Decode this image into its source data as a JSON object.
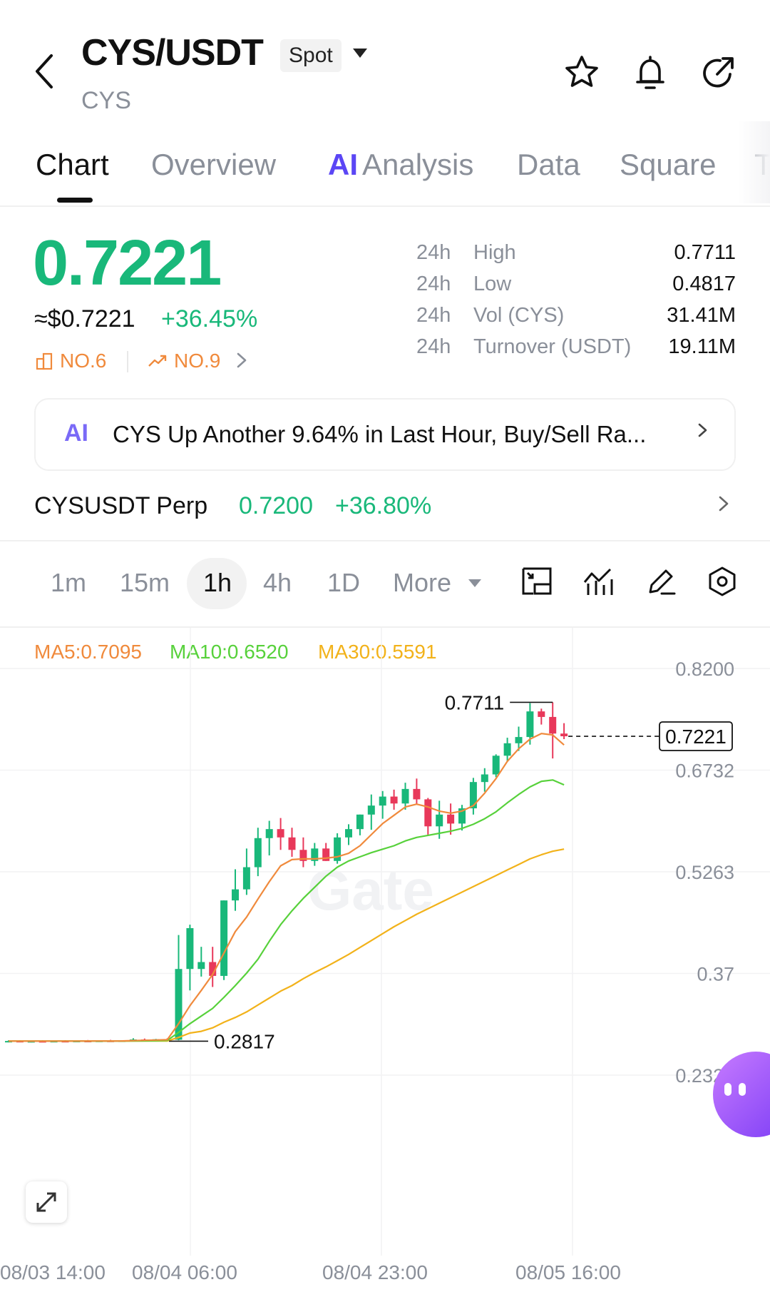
{
  "header": {
    "pair": "CYS/USDT",
    "market_type": "Spot",
    "base_asset": "CYS",
    "icons": [
      "back-arrow-icon",
      "star-icon",
      "bell-icon",
      "share-icon"
    ]
  },
  "tabs": [
    {
      "label": "Chart",
      "active": true
    },
    {
      "label": "Overview",
      "active": false
    },
    {
      "label": "Analysis",
      "prefix": "AI",
      "active": false
    },
    {
      "label": "Data",
      "active": false
    },
    {
      "label": "Square",
      "active": false
    },
    {
      "label": "T",
      "active": false
    }
  ],
  "price": {
    "last": "0.7221",
    "usd_approx": "≈$0.7221",
    "change_pct": "+36.45%",
    "rank_1": "NO.6",
    "rank_2": "NO.9"
  },
  "stats": [
    {
      "period": "24h",
      "label": "High",
      "value": "0.7711"
    },
    {
      "period": "24h",
      "label": "Low",
      "value": "0.4817"
    },
    {
      "period": "24h",
      "label": "Vol (CYS)",
      "value": "31.41M"
    },
    {
      "period": "24h",
      "label": "Turnover (USDT)",
      "value": "19.11M"
    }
  ],
  "news": {
    "ai_tag": "AI",
    "headline": "CYS Up Another 9.64% in Last Hour, Buy/Sell Ra..."
  },
  "perp": {
    "name": "CYSUSDT Perp",
    "price": "0.7200",
    "change_pct": "+36.80%"
  },
  "intervals": {
    "items": [
      "1m",
      "15m",
      "1h",
      "4h",
      "1D",
      "More"
    ],
    "selected": "1h"
  },
  "ma": {
    "ma5": "MA5:0.7095",
    "ma10": "MA10:0.6520",
    "ma30": "MA30:0.5591"
  },
  "colors": {
    "up": "#19b87a",
    "down": "#e8385a",
    "ma5": "#f08a3c",
    "ma10": "#57d13b",
    "ma30": "#f2b21a",
    "accent": "#5b46f5"
  },
  "chart_data": {
    "type": "candlestick",
    "interval": "1h",
    "y_ticks": [
      "0.8200",
      "0.6732",
      "0.5263",
      "0.37",
      "0.2327"
    ],
    "x_ticks": [
      "08/03 14:00",
      "08/04 06:00",
      "08/04 23:00",
      "08/05 16:00"
    ],
    "ylim": [
      0.2327,
      0.82
    ],
    "high_marker": "0.7711",
    "low_marker": "0.2817",
    "last_price_tag": "0.7221",
    "watermark": "Gate",
    "candles": [
      {
        "o": 0.281,
        "h": 0.283,
        "l": 0.28,
        "c": 0.282
      },
      {
        "o": 0.282,
        "h": 0.283,
        "l": 0.2805,
        "c": 0.2812
      },
      {
        "o": 0.2812,
        "h": 0.2825,
        "l": 0.28,
        "c": 0.2818
      },
      {
        "o": 0.2818,
        "h": 0.283,
        "l": 0.2808,
        "c": 0.2814
      },
      {
        "o": 0.2814,
        "h": 0.2826,
        "l": 0.2802,
        "c": 0.282
      },
      {
        "o": 0.282,
        "h": 0.2832,
        "l": 0.281,
        "c": 0.2816
      },
      {
        "o": 0.2816,
        "h": 0.2824,
        "l": 0.2806,
        "c": 0.2822
      },
      {
        "o": 0.2822,
        "h": 0.2834,
        "l": 0.2812,
        "c": 0.2818
      },
      {
        "o": 0.2818,
        "h": 0.2828,
        "l": 0.281,
        "c": 0.2824
      },
      {
        "o": 0.2824,
        "h": 0.2836,
        "l": 0.2814,
        "c": 0.282
      },
      {
        "o": 0.282,
        "h": 0.283,
        "l": 0.2817,
        "c": 0.2826
      },
      {
        "o": 0.2826,
        "h": 0.286,
        "l": 0.2818,
        "c": 0.2842
      },
      {
        "o": 0.2842,
        "h": 0.2855,
        "l": 0.283,
        "c": 0.2835
      },
      {
        "o": 0.2835,
        "h": 0.285,
        "l": 0.2822,
        "c": 0.2845
      },
      {
        "o": 0.2845,
        "h": 0.2858,
        "l": 0.283,
        "c": 0.2838
      },
      {
        "o": 0.2838,
        "h": 0.435,
        "l": 0.283,
        "c": 0.386
      },
      {
        "o": 0.386,
        "h": 0.45,
        "l": 0.355,
        "c": 0.445
      },
      {
        "o": 0.386,
        "h": 0.418,
        "l": 0.375,
        "c": 0.396
      },
      {
        "o": 0.396,
        "h": 0.418,
        "l": 0.36,
        "c": 0.376
      },
      {
        "o": 0.376,
        "h": 0.485,
        "l": 0.37,
        "c": 0.485
      },
      {
        "o": 0.485,
        "h": 0.53,
        "l": 0.47,
        "c": 0.501
      },
      {
        "o": 0.501,
        "h": 0.56,
        "l": 0.493,
        "c": 0.533
      },
      {
        "o": 0.533,
        "h": 0.59,
        "l": 0.52,
        "c": 0.575
      },
      {
        "o": 0.575,
        "h": 0.6,
        "l": 0.55,
        "c": 0.588
      },
      {
        "o": 0.588,
        "h": 0.604,
        "l": 0.558,
        "c": 0.576
      },
      {
        "o": 0.576,
        "h": 0.59,
        "l": 0.548,
        "c": 0.558
      },
      {
        "o": 0.558,
        "h": 0.576,
        "l": 0.533,
        "c": 0.542
      },
      {
        "o": 0.542,
        "h": 0.568,
        "l": 0.535,
        "c": 0.56
      },
      {
        "o": 0.56,
        "h": 0.568,
        "l": 0.542,
        "c": 0.542
      },
      {
        "o": 0.542,
        "h": 0.582,
        "l": 0.538,
        "c": 0.576
      },
      {
        "o": 0.576,
        "h": 0.595,
        "l": 0.565,
        "c": 0.588
      },
      {
        "o": 0.588,
        "h": 0.609,
        "l": 0.579,
        "c": 0.609
      },
      {
        "o": 0.609,
        "h": 0.638,
        "l": 0.587,
        "c": 0.622
      },
      {
        "o": 0.622,
        "h": 0.643,
        "l": 0.603,
        "c": 0.635
      },
      {
        "o": 0.635,
        "h": 0.645,
        "l": 0.616,
        "c": 0.625
      },
      {
        "o": 0.625,
        "h": 0.655,
        "l": 0.616,
        "c": 0.646
      },
      {
        "o": 0.646,
        "h": 0.661,
        "l": 0.624,
        "c": 0.631
      },
      {
        "o": 0.631,
        "h": 0.633,
        "l": 0.58,
        "c": 0.592
      },
      {
        "o": 0.592,
        "h": 0.629,
        "l": 0.574,
        "c": 0.609
      },
      {
        "o": 0.609,
        "h": 0.625,
        "l": 0.58,
        "c": 0.596
      },
      {
        "o": 0.596,
        "h": 0.623,
        "l": 0.586,
        "c": 0.618
      },
      {
        "o": 0.618,
        "h": 0.662,
        "l": 0.609,
        "c": 0.656
      },
      {
        "o": 0.656,
        "h": 0.676,
        "l": 0.642,
        "c": 0.667
      },
      {
        "o": 0.667,
        "h": 0.696,
        "l": 0.663,
        "c": 0.694
      },
      {
        "o": 0.694,
        "h": 0.72,
        "l": 0.685,
        "c": 0.712
      },
      {
        "o": 0.712,
        "h": 0.736,
        "l": 0.701,
        "c": 0.721
      },
      {
        "o": 0.721,
        "h": 0.77,
        "l": 0.71,
        "c": 0.758
      },
      {
        "o": 0.758,
        "h": 0.762,
        "l": 0.739,
        "c": 0.75
      },
      {
        "o": 0.75,
        "h": 0.7711,
        "l": 0.69,
        "c": 0.726
      },
      {
        "o": 0.726,
        "h": 0.741,
        "l": 0.718,
        "c": 0.7221
      }
    ],
    "ma5": [
      0.2818,
      0.2818,
      0.2817,
      0.2817,
      0.2818,
      0.2818,
      0.2818,
      0.2819,
      0.2819,
      0.282,
      0.2821,
      0.2826,
      0.283,
      0.2834,
      0.2838,
      0.307,
      0.333,
      0.355,
      0.378,
      0.409,
      0.44,
      0.461,
      0.487,
      0.512,
      0.535,
      0.544,
      0.545,
      0.545,
      0.546,
      0.548,
      0.553,
      0.564,
      0.58,
      0.596,
      0.608,
      0.62,
      0.624,
      0.62,
      0.614,
      0.611,
      0.614,
      0.622,
      0.64,
      0.661,
      0.686,
      0.704,
      0.718,
      0.726,
      0.724,
      0.7095
    ],
    "ma10": [
      0.2818,
      0.2818,
      0.2818,
      0.2818,
      0.2818,
      0.2818,
      0.2818,
      0.2818,
      0.2818,
      0.2818,
      0.2819,
      0.282,
      0.2822,
      0.2824,
      0.2828,
      0.2944,
      0.307,
      0.318,
      0.329,
      0.345,
      0.362,
      0.38,
      0.4,
      0.426,
      0.45,
      0.47,
      0.488,
      0.504,
      0.52,
      0.533,
      0.542,
      0.548,
      0.554,
      0.559,
      0.564,
      0.571,
      0.576,
      0.579,
      0.582,
      0.585,
      0.589,
      0.595,
      0.603,
      0.613,
      0.626,
      0.638,
      0.649,
      0.657,
      0.659,
      0.652
    ],
    "ma30": [
      0.2818,
      0.2818,
      0.2818,
      0.2818,
      0.2818,
      0.2818,
      0.2818,
      0.2818,
      0.2818,
      0.2818,
      0.2818,
      0.2819,
      0.2819,
      0.282,
      0.2821,
      0.2871,
      0.2935,
      0.296,
      0.301,
      0.309,
      0.316,
      0.324,
      0.334,
      0.344,
      0.354,
      0.362,
      0.372,
      0.381,
      0.389,
      0.398,
      0.407,
      0.417,
      0.427,
      0.437,
      0.447,
      0.456,
      0.465,
      0.473,
      0.481,
      0.489,
      0.497,
      0.505,
      0.513,
      0.521,
      0.529,
      0.537,
      0.545,
      0.551,
      0.556,
      0.5591
    ]
  }
}
